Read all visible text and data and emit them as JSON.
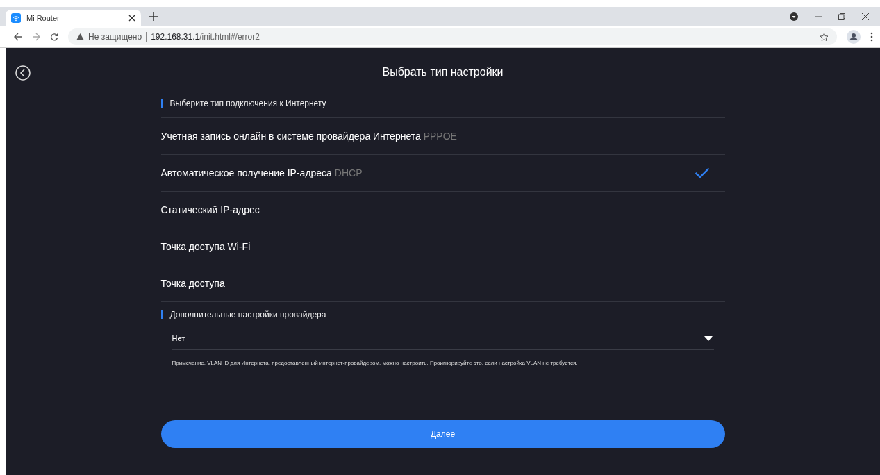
{
  "browser": {
    "tab_title": "Mi Router",
    "security": "Не защищено",
    "url_host": "192.168.31.1",
    "url_path": "/init.html#/error2"
  },
  "page": {
    "title": "Выбрать тип настройки",
    "section_label": "Выберите тип подключения к Интернету",
    "options": [
      {
        "label": "Учетная запись онлайн в системе провайдера Интернета",
        "tag": "PPPOE",
        "selected": false
      },
      {
        "label": "Автоматическое получение IP-адреса",
        "tag": "DHCP",
        "selected": true
      },
      {
        "label": "Статический IP-адрес",
        "selected": false
      },
      {
        "label": "Точка доступа Wi-Fi",
        "selected": false
      },
      {
        "label": "Точка доступа",
        "selected": false
      }
    ],
    "advanced_label": "Дополнительные настройки провайдера",
    "vlan_value": "Нет",
    "note": "Примечание. VLAN ID для Интернета, предоставленный интернет-провайдером, можно настроить. Проигнорируйте это, если настройка VLAN не требуется.",
    "next_button": "Далее"
  }
}
